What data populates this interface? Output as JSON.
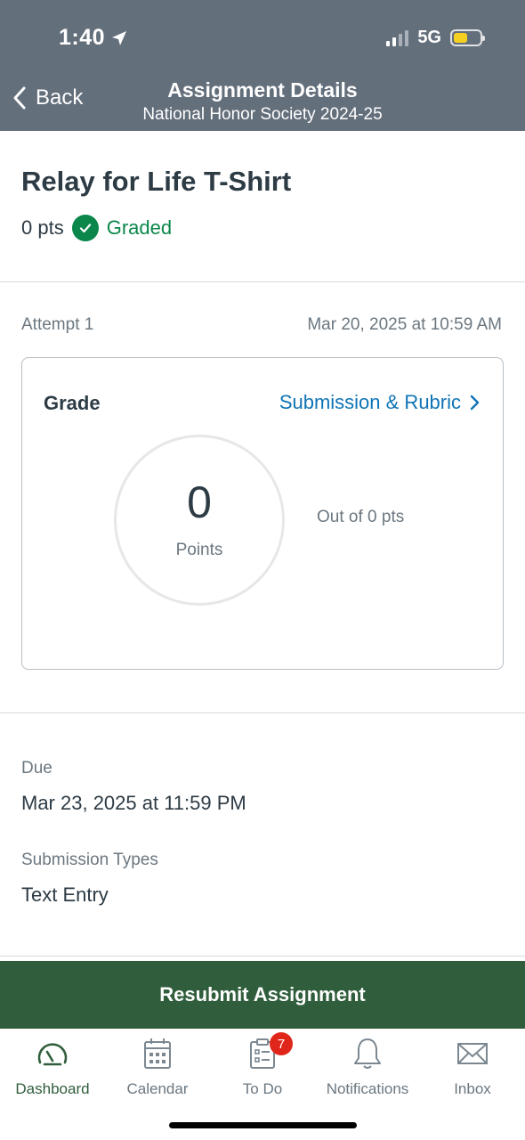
{
  "status_bar": {
    "time": "1:40",
    "network": "5G"
  },
  "header": {
    "back_label": "Back",
    "title": "Assignment Details",
    "subtitle": "National Honor Society 2024-25"
  },
  "assignment": {
    "title": "Relay for Life T-Shirt",
    "points": "0 pts",
    "status": "Graded"
  },
  "attempt": {
    "label": "Attempt 1",
    "date": "Mar 20, 2025 at 10:59 AM"
  },
  "grade_card": {
    "heading": "Grade",
    "link_label": "Submission & Rubric",
    "score": "0",
    "score_label": "Points",
    "out_of": "Out of 0 pts"
  },
  "details": {
    "due_label": "Due",
    "due_value": "Mar 23, 2025 at 11:59 PM",
    "types_label": "Submission Types",
    "types_value": "Text Entry"
  },
  "resubmit_label": "Resubmit Assignment",
  "tabs": [
    {
      "label": "Dashboard",
      "icon": "dashboard-icon",
      "active": true
    },
    {
      "label": "Calendar",
      "icon": "calendar-icon"
    },
    {
      "label": "To Do",
      "icon": "todo-icon",
      "badge": "7"
    },
    {
      "label": "Notifications",
      "icon": "bell-icon"
    },
    {
      "label": "Inbox",
      "icon": "envelope-icon"
    }
  ],
  "colors": {
    "header_bg": "#646f7c",
    "graded_green": "#0b874b",
    "link_blue": "#0f74b5",
    "resubmit_bg": "#305e3c",
    "badge_red": "#e0261b"
  }
}
